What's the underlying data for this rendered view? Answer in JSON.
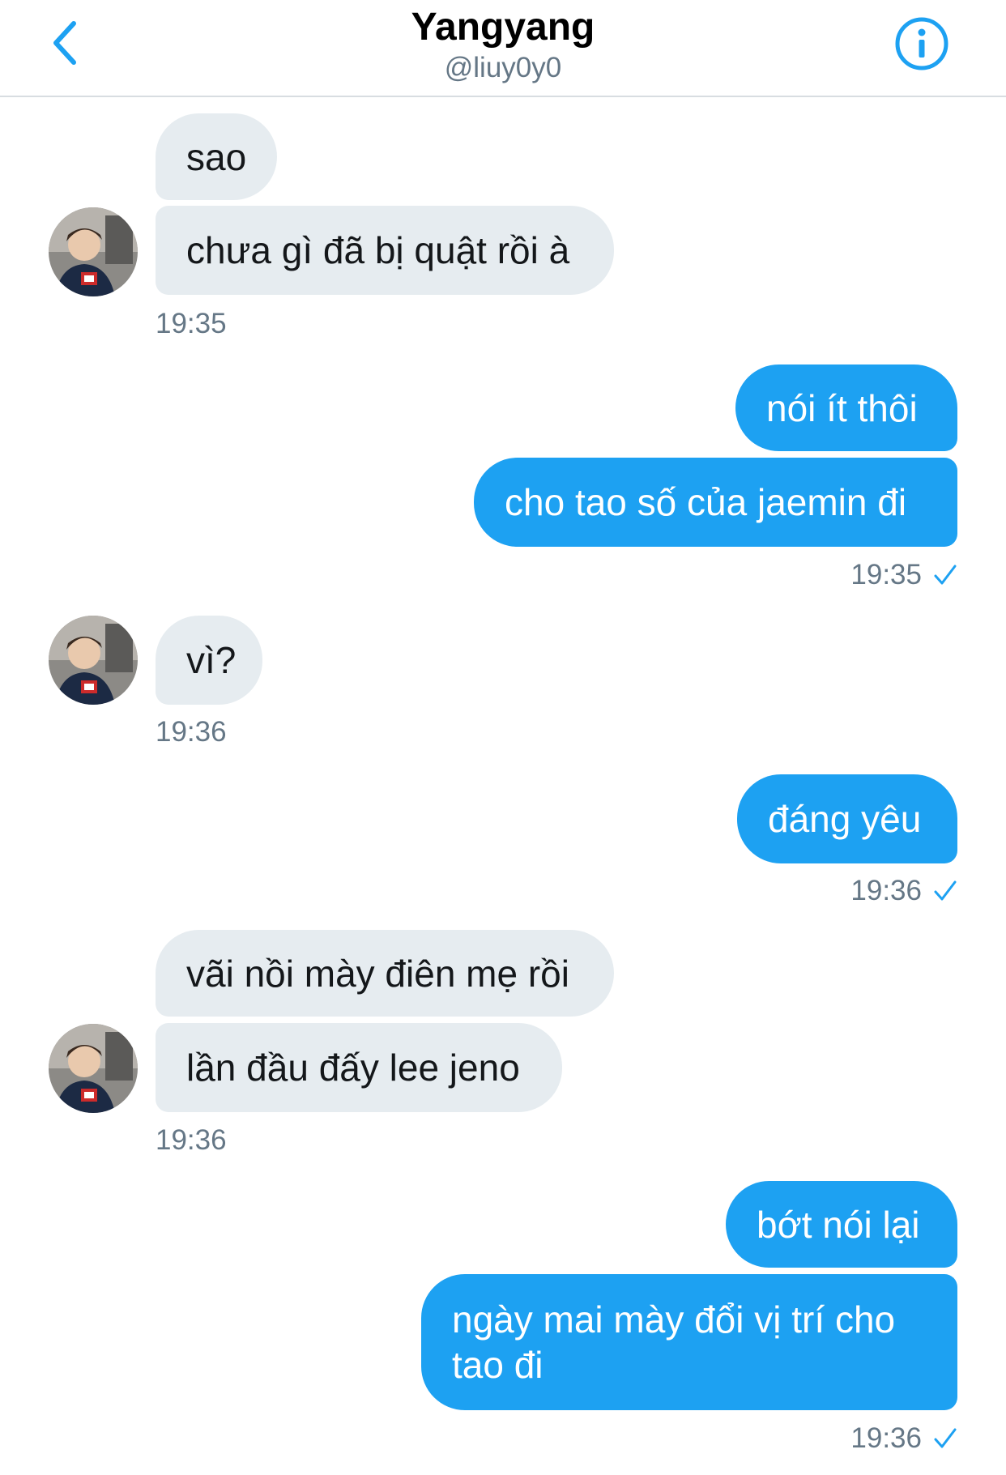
{
  "header": {
    "title": "Yangyang",
    "handle": "@liuy0y0"
  },
  "colors": {
    "accent": "#1da1f2",
    "received_bubble": "#e6ecf0",
    "timestamp": "#657786"
  },
  "messages": [
    {
      "direction": "received",
      "text": "sao"
    },
    {
      "direction": "received",
      "text": "chưa gì đã bị quật rồi à"
    },
    {
      "direction": "received_time",
      "text": "19:35"
    },
    {
      "direction": "sent",
      "text": "nói ít thôi"
    },
    {
      "direction": "sent",
      "text": "cho tao số của jaemin đi"
    },
    {
      "direction": "sent_time",
      "text": "19:35"
    },
    {
      "direction": "received",
      "text": "vì?"
    },
    {
      "direction": "received_time",
      "text": "19:36"
    },
    {
      "direction": "sent",
      "text": "đáng yêu"
    },
    {
      "direction": "sent_time",
      "text": "19:36"
    },
    {
      "direction": "received",
      "text": "vãi nồi mày điên mẹ rồi"
    },
    {
      "direction": "received",
      "text": "lần đầu đấy lee jeno"
    },
    {
      "direction": "received_time",
      "text": "19:36"
    },
    {
      "direction": "sent",
      "text": "bớt nói lại"
    },
    {
      "direction": "sent",
      "text": "ngày mai mày đổi vị trí cho tao đi"
    },
    {
      "direction": "sent_time",
      "text": "19:36"
    }
  ],
  "icons": {
    "back": "chevron-left-icon",
    "info": "info-icon",
    "read_receipt": "checkmark-icon",
    "avatar": "avatar"
  }
}
